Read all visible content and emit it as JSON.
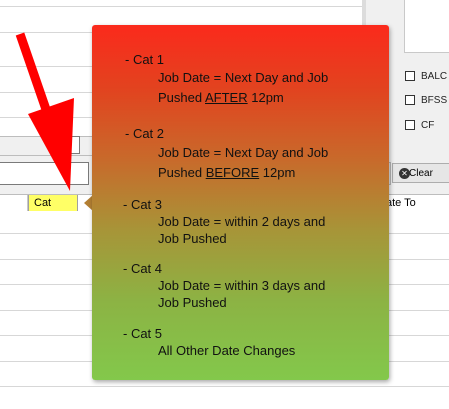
{
  "grid": {
    "cat_column_header": "Cat",
    "date_to_column_header": "ate To"
  },
  "filters": {
    "checkboxes": [
      {
        "label": "BALC",
        "checked": false
      },
      {
        "label": "BFSS",
        "checked": false
      },
      {
        "label": "CF",
        "checked": false
      }
    ],
    "clear_button_label": "Clear"
  },
  "arrow": {
    "color": "#ff0000"
  },
  "callout": {
    "gradient_top": "#fb2a1c",
    "gradient_bottom": "#83c84b",
    "categories": [
      {
        "title": "- Cat 1",
        "line1": "Job Date = Next Day and Job",
        "line2_prefix": "Pushed ",
        "line2_emphasis": "AFTER",
        "line2_suffix": " 12pm"
      },
      {
        "title": "- Cat 2",
        "line1": "Job Date = Next Day and Job",
        "line2_prefix": "Pushed ",
        "line2_emphasis": "BEFORE",
        "line2_suffix": " 12pm"
      },
      {
        "title": "- Cat 3",
        "line1": "Job Date = within 2 days and",
        "line2": "Job Pushed"
      },
      {
        "title": "- Cat 4",
        "line1": "Job Date = within 3 days and",
        "line2": "Job Pushed"
      },
      {
        "title": "- Cat 5",
        "line1": "All Other Date Changes"
      }
    ]
  }
}
